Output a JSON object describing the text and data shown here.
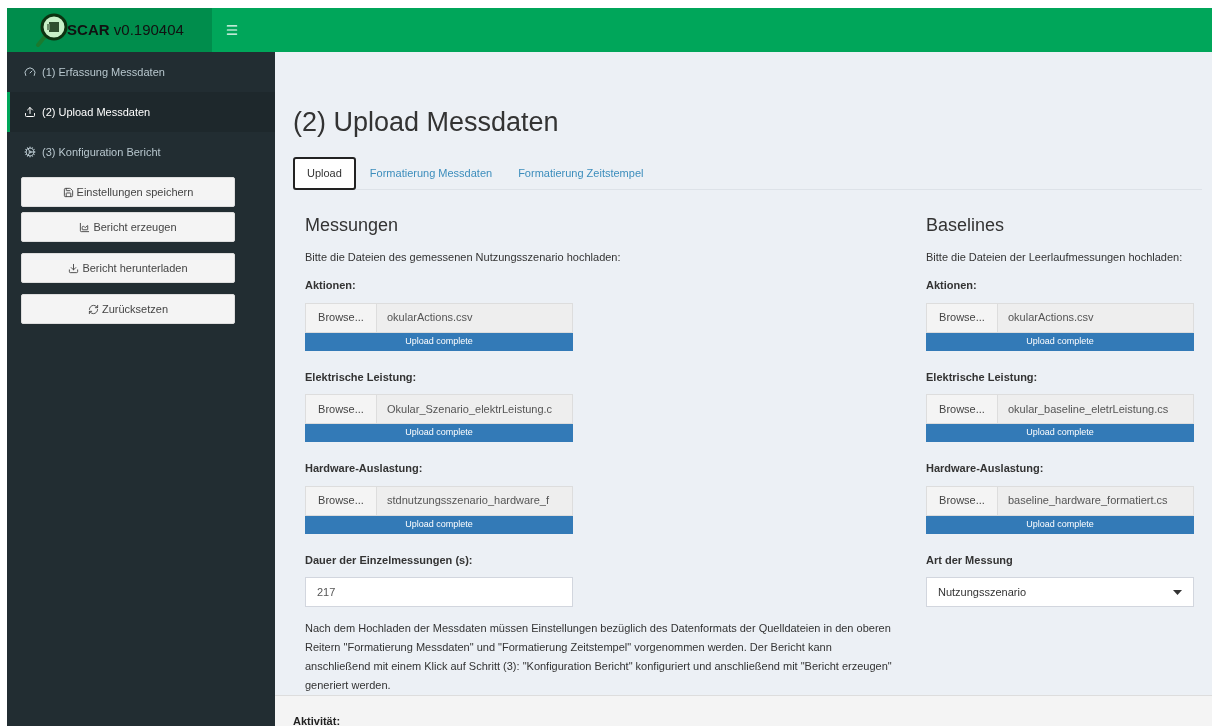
{
  "header": {
    "app_name": "SCAR v0.190404"
  },
  "sidebar": {
    "items": [
      {
        "label": "(1) Erfassung Messdaten",
        "kind": "gauge",
        "selected": false
      },
      {
        "label": "(2) Upload Messdaten",
        "kind": "upload",
        "selected": true
      },
      {
        "label": "(3) Konfiguration Bericht",
        "kind": "cogs",
        "selected": false
      }
    ],
    "buttons": [
      {
        "label": "Einstellungen speichern",
        "kind": "save"
      },
      {
        "label": "Bericht erzeugen",
        "kind": "chart"
      },
      {
        "label": "Bericht herunterladen",
        "kind": "download"
      },
      {
        "label": "Zurücksetzen",
        "kind": "reset"
      }
    ]
  },
  "page_title": "(2) Upload Messdaten",
  "tabs": [
    {
      "label": "Upload",
      "selected": true
    },
    {
      "label": "Formatierung Messdaten",
      "selected": false
    },
    {
      "label": "Formatierung Zeitstempel",
      "selected": false
    }
  ],
  "columns": [
    {
      "heading": "Messungen",
      "intro": "Bitte die Dateien des gemessenen Nutzungsszenario hochladen:",
      "uploads": [
        {
          "label": "Aktionen:",
          "button": "Browse...",
          "file": "okularActions.csv",
          "status": "Upload complete",
          "level": 1
        },
        {
          "label": "Elektrische Leistung:",
          "button": "Browse...",
          "file": "Okular_Szenario_elektrLeistung.c",
          "status": "Upload complete",
          "level": 1
        },
        {
          "label": "Hardware-Auslastung:",
          "button": "Browse...",
          "file": "stdnutzungsszenario_hardware_f",
          "status": "Upload complete",
          "level": 1
        }
      ],
      "field": {
        "kind": "text",
        "label": "Dauer der Einzelmessungen (s):",
        "value": "217"
      },
      "note": "Nach dem Hochladen der Messdaten müssen Einstellungen bezüglich des Datenformats der Quelldateien in den oberen Reitern \"Formatierung Messdaten\" und \"Formatierung Zeitstempel\" vorgenommen werden. Der Bericht kann anschließend mit einem Klick auf Schritt (3): \"Konfiguration Bericht\" konfiguriert und anschließend mit \"Bericht erzeugen\" generiert werden."
    },
    {
      "heading": "Baselines",
      "intro": "Bitte die Dateien der Leerlaufmessungen hochladen:",
      "uploads": [
        {
          "label": "Aktionen:",
          "button": "Browse...",
          "file": "okularActions.csv",
          "status": "Upload complete",
          "level": 1
        },
        {
          "label": "Elektrische Leistung:",
          "button": "Browse...",
          "file": "okular_baseline_eletrLeistung.cs",
          "status": "Upload complete",
          "level": 1
        },
        {
          "label": "Hardware-Auslastung:",
          "button": "Browse...",
          "file": "baseline_hardware_formatiert.cs",
          "status": "Upload complete",
          "level": 1
        }
      ],
      "field": {
        "kind": "select",
        "label": "Art der Messung",
        "value": "Nutzungsszenario"
      }
    }
  ],
  "footer": {
    "label": "Aktivität:"
  }
}
